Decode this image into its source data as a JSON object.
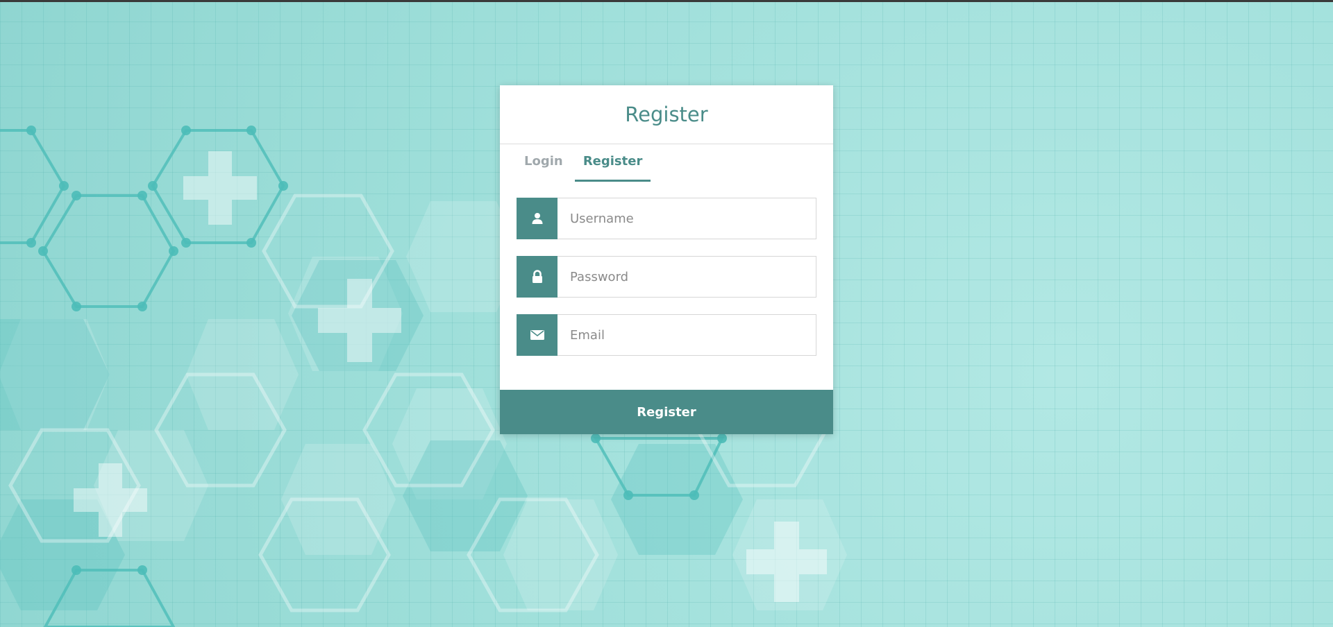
{
  "card": {
    "title": "Register"
  },
  "tabs": [
    {
      "label": "Login",
      "active": false
    },
    {
      "label": "Register",
      "active": true
    }
  ],
  "fields": {
    "username": {
      "placeholder": "Username",
      "icon": "user-icon"
    },
    "password": {
      "placeholder": "Password",
      "icon": "lock-icon"
    },
    "email": {
      "placeholder": "Email",
      "icon": "envelope-icon"
    }
  },
  "submit": {
    "label": "Register"
  },
  "colors": {
    "accent": "#4a8c89",
    "tab_inactive": "#a0a8ac",
    "background": "#a3e1dd"
  }
}
